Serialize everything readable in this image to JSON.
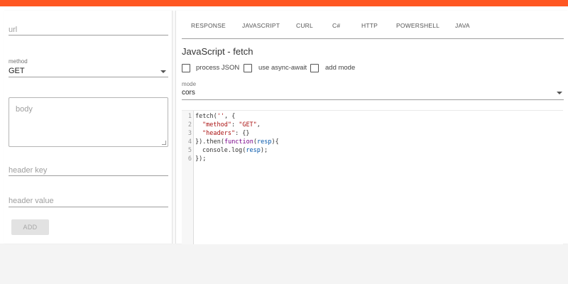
{
  "colors": {
    "accent": "#ff5722"
  },
  "form": {
    "url_placeholder": "url",
    "method_label": "method",
    "method_value": "GET",
    "body_placeholder": "body",
    "header_key_placeholder": "header key",
    "header_value_placeholder": "header value",
    "add_label": "ADD"
  },
  "tabs": [
    "RESPONSE",
    "JAVASCRIPT",
    "CURL",
    "C#",
    "HTTP",
    "POWERSHELL",
    "JAVA"
  ],
  "snippet": {
    "title": "JavaScript - fetch",
    "options": [
      {
        "label": "process JSON",
        "checked": false
      },
      {
        "label": "use async-await",
        "checked": false
      },
      {
        "label": "add mode",
        "checked": false
      }
    ],
    "mode_label": "mode",
    "mode_value": "cors",
    "code": {
      "line_numbers": [
        "1",
        "2",
        "3",
        "4",
        "5",
        "6"
      ],
      "l1_a": "fetch(",
      "l1_str": "''",
      "l1_b": ", {",
      "l2_key": "\"method\"",
      "l2_sep": ": ",
      "l2_val": "\"GET\"",
      "l2_end": ",",
      "l3_key": "\"headers\"",
      "l3_rest": ": {}",
      "l4_a": "}).then(",
      "l4_kw": "function",
      "l4_b": "(",
      "l4_var": "resp",
      "l4_c": "){",
      "l5_a": "console.log(",
      "l5_var": "resp",
      "l5_b": ");",
      "l6": "});"
    }
  }
}
